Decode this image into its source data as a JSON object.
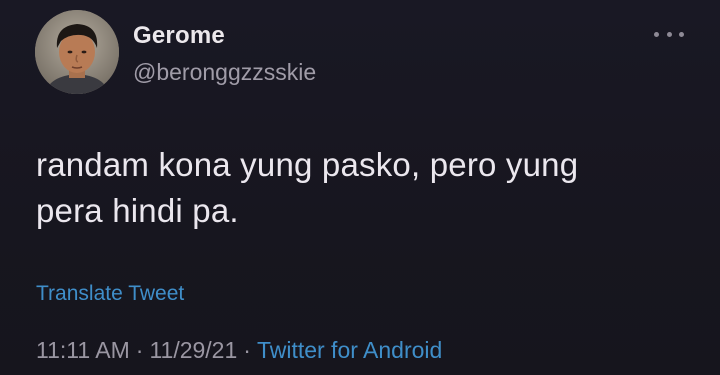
{
  "tweet": {
    "author": {
      "display_name": "Gerome",
      "handle": "@beronggzzsskie"
    },
    "text_lines": [
      "randam kona yung pasko, pero yung",
      "pera hindi pa."
    ],
    "translate_label": "Translate Tweet",
    "meta": {
      "time": "11:11 AM",
      "separator": "·",
      "date": "11/29/21",
      "source": "Twitter for Android"
    }
  },
  "icons": {
    "more": "more-horizontal-icon",
    "avatar": "profile-photo"
  },
  "colors": {
    "background": "#17161f",
    "link": "#3f8ec9",
    "text_primary": "#ebe7ee",
    "text_secondary": "#9a96a2"
  }
}
